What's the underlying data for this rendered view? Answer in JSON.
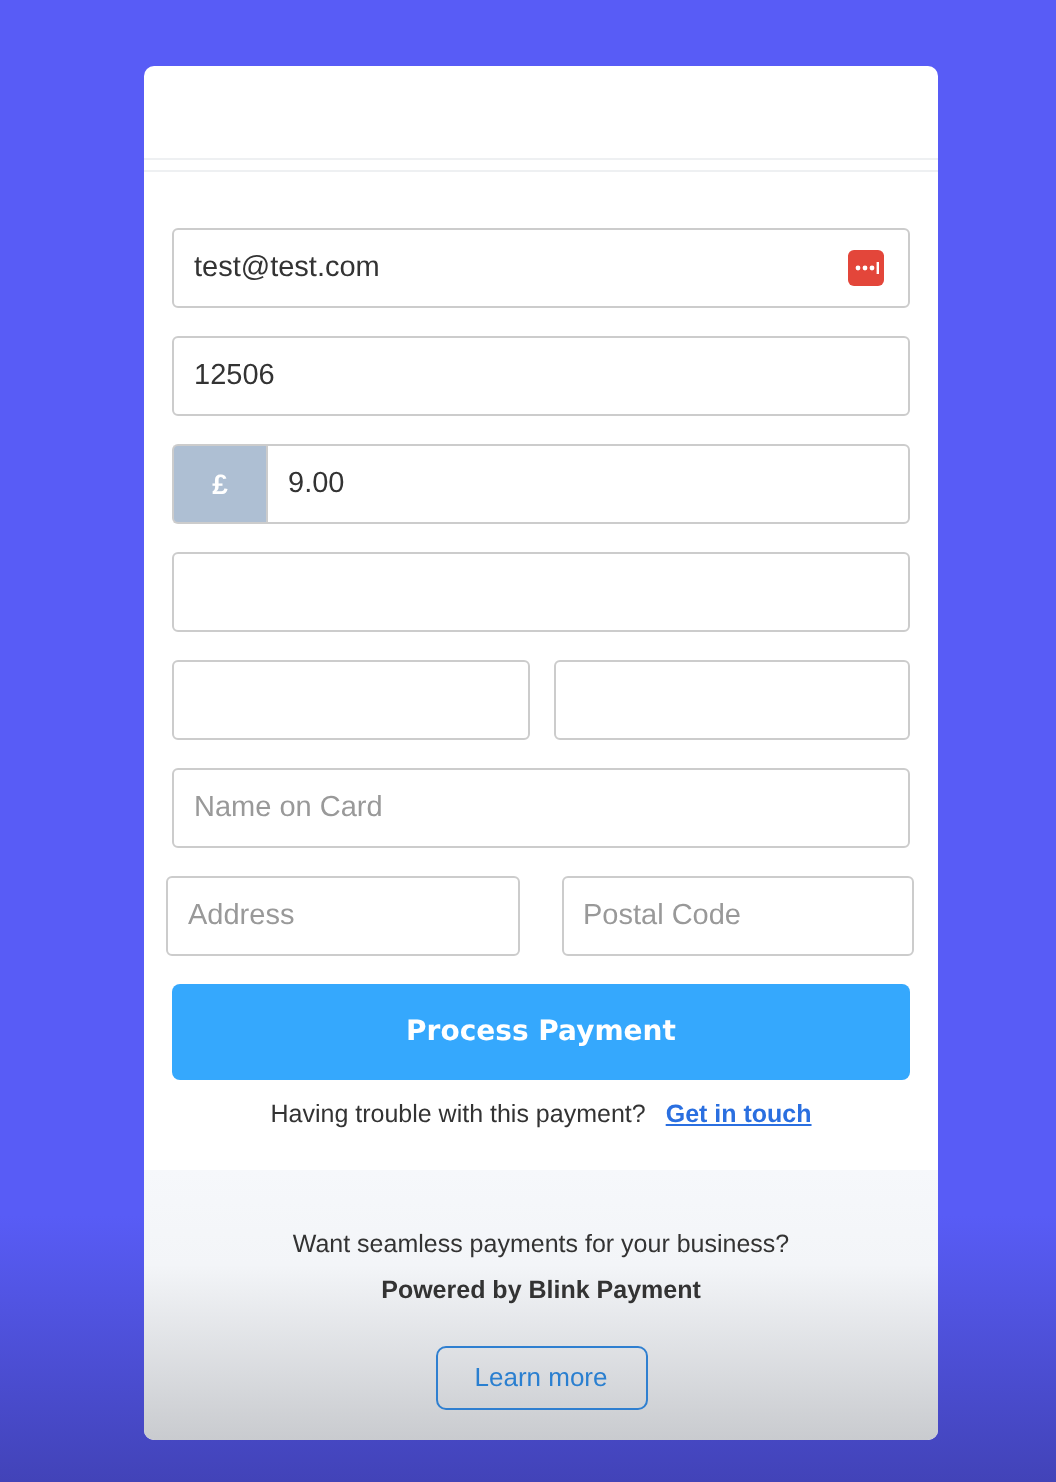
{
  "form": {
    "rows": [
      {
        "fields": [
          {
            "kind": "input",
            "value": "test@test.com",
            "password_manager": true
          }
        ]
      },
      {
        "fields": [
          {
            "kind": "input",
            "value": "12506"
          }
        ]
      },
      {
        "fields": [
          {
            "kind": "currency",
            "prefix": "£",
            "value": "9.00"
          }
        ]
      },
      {
        "fields": [
          {
            "kind": "input"
          }
        ]
      },
      {
        "fields": [
          {
            "kind": "input"
          },
          {
            "kind": "input"
          }
        ]
      },
      {
        "fields": [
          {
            "kind": "input",
            "placeholder": "Name on Card"
          }
        ]
      },
      {
        "fields": [
          {
            "kind": "input",
            "placeholder": "Address"
          },
          {
            "kind": "input",
            "placeholder": "Postal Code"
          }
        ],
        "wide": true
      }
    ],
    "submit": "Process Payment",
    "help_text": "Having trouble with this payment?",
    "help_link": "Get in touch"
  },
  "footer": {
    "text": "Want seamless payments for your business?",
    "powered_by": "Powered by Blink Payment",
    "button": "Learn more"
  }
}
